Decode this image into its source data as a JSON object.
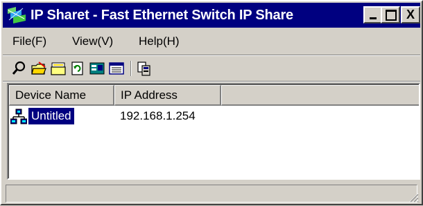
{
  "window": {
    "title": "IP Sharet - Fast Ethernet Switch IP Share",
    "minimize_icon": "minimize-icon",
    "maximize_icon": "maximize-icon",
    "close_label": "X"
  },
  "menu": {
    "items": [
      {
        "label": "File(F)",
        "name": "menu-file"
      },
      {
        "label": "View(V)",
        "name": "menu-view"
      },
      {
        "label": "Help(H)",
        "name": "menu-help"
      }
    ]
  },
  "toolbar": {
    "tools": [
      "search-icon",
      "open-folder-icon",
      "folder-icon",
      "refresh-icon",
      "device-properties-icon",
      "list-view-icon",
      "copy-icon"
    ]
  },
  "list": {
    "columns": [
      {
        "label": "Device Name"
      },
      {
        "label": "IP Address"
      }
    ],
    "rows": [
      {
        "name": "Untitled",
        "ip": "192.168.1.254",
        "selected": true,
        "icon": "network-device-icon"
      }
    ]
  },
  "statusbar": {
    "text": ""
  },
  "colors": {
    "title_bar": "#000080",
    "selection": "#000080",
    "face": "#d4d0c8"
  }
}
